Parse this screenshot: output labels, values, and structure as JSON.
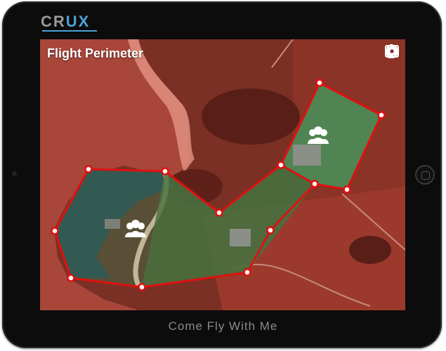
{
  "brand": {
    "part1": "CR",
    "part2": "UX"
  },
  "screen": {
    "title": "Flight Perimeter"
  },
  "status_icons": [
    "battery-icon",
    "wifi-icon",
    "cloud-upload-icon",
    "image-icon",
    "gear-icon"
  ],
  "map": {
    "zones": [
      "group-icon",
      "group-icon"
    ]
  },
  "tagline": "Come Fly With Me",
  "colors": {
    "accent": "#4aa3d9",
    "perimeter": "#e01010",
    "overlay": "#8e1f14"
  }
}
